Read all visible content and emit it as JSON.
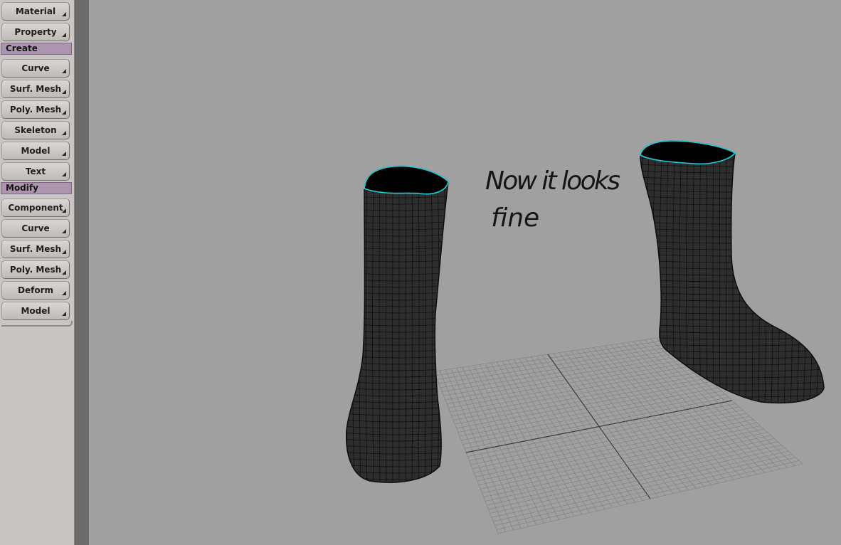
{
  "sidebar": {
    "top_buttons": [
      {
        "label": "Material"
      },
      {
        "label": "Property"
      }
    ],
    "create_header": "Create",
    "create_buttons": [
      {
        "label": "Curve"
      },
      {
        "label": "Surf. Mesh"
      },
      {
        "label": "Poly. Mesh"
      },
      {
        "label": "Skeleton"
      },
      {
        "label": "Model"
      },
      {
        "label": "Text"
      }
    ],
    "modify_header": "Modify",
    "modify_buttons": [
      {
        "label": "Component"
      },
      {
        "label": "Curve"
      },
      {
        "label": "Surf. Mesh"
      },
      {
        "label": "Poly. Mesh"
      },
      {
        "label": "Deform"
      },
      {
        "label": "Model"
      }
    ]
  },
  "viewport": {
    "annotation_line1": "Now it looks",
    "annotation_line2": "fine",
    "colors": {
      "background": "#a0a0a0",
      "mesh_fill": "#2e2e2e",
      "wire": "#0c0c0c",
      "selection_edge": "#22d0d8",
      "grid": "#7e7e7e",
      "grid_axis": "#3a3a3a"
    }
  }
}
